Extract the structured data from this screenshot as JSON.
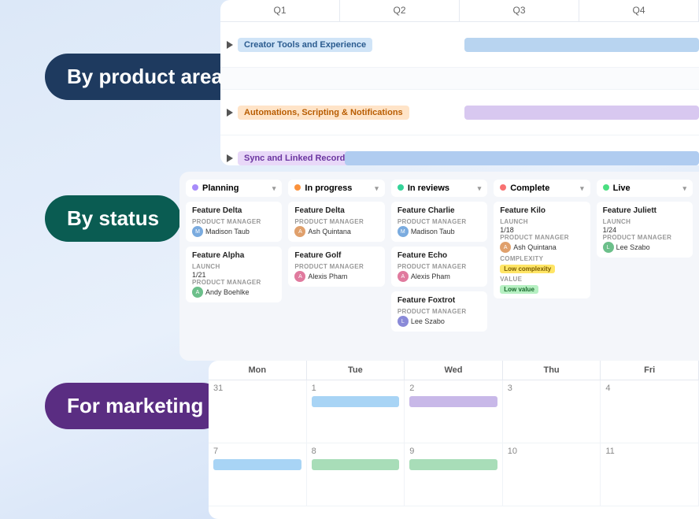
{
  "section1": {
    "label": "By product area",
    "quarters": [
      "Q1",
      "Q2",
      "Q3",
      "Q4"
    ],
    "rows": [
      {
        "name": "Creator Tools and Experience",
        "tag_class": "tag-blue"
      },
      {
        "name": "Automations, Scripting & Notifications",
        "tag_class": "tag-orange"
      },
      {
        "name": "Sync and Linked Records",
        "tag_class": "tag-purple-light"
      }
    ]
  },
  "section2": {
    "label": "By status",
    "columns": [
      {
        "status": "Planning",
        "color": "#a78bfa",
        "cards": [
          {
            "title": "Feature Delta",
            "pm_label": "PRODUCT MANAGER",
            "pm": "Madison Taub",
            "avatar_class": "blue"
          },
          {
            "title": "Feature Alpha",
            "launch_label": "LAUNCH",
            "launch": "1/21",
            "pm_label": "PRODUCT MANAGER",
            "pm": "Andy Boehlke",
            "avatar_class": "green"
          }
        ]
      },
      {
        "status": "In progress",
        "color": "#fb923c",
        "cards": [
          {
            "title": "Feature Delta",
            "pm_label": "PRODUCT MANAGER",
            "pm": "Ash Quintana",
            "avatar_class": "orange"
          },
          {
            "title": "Feature Golf",
            "pm_label": "PRODUCT MANAGER",
            "pm": "Alexis Pham",
            "avatar_class": "pink"
          }
        ]
      },
      {
        "status": "In reviews",
        "color": "#34d399",
        "cards": [
          {
            "title": "Feature Charlie",
            "pm_label": "PRODUCT MANAGER",
            "pm": "Madison Taub",
            "avatar_class": "blue"
          },
          {
            "title": "Feature Echo",
            "pm_label": "PRODUCT MANAGER",
            "pm": "Alexis Pham",
            "avatar_class": "pink"
          },
          {
            "title": "Feature Foxtrot",
            "pm_label": "PRODUCT MANAGER",
            "pm": "Lee Szabo",
            "avatar_class": "purple"
          }
        ]
      },
      {
        "status": "Complete",
        "color": "#f87171",
        "cards": [
          {
            "title": "Feature Kilo",
            "launch_label": "LAUNCH",
            "launch": "1/18",
            "pm_label": "PRODUCT MANAGER",
            "pm": "Ash Quintana",
            "avatar_class": "orange",
            "complexity_label": "COMPLEXITY",
            "complexity": "Low complexity",
            "value_label": "VALUE",
            "value": "Low value"
          }
        ]
      },
      {
        "status": "Live",
        "color": "#4ade80",
        "cards": [
          {
            "title": "Feature Juliett",
            "launch_label": "LAUNCH",
            "launch": "1/24",
            "pm_label": "PRODUCT MANAGER",
            "pm": "Lee Szabo",
            "avatar_class": "green"
          }
        ]
      }
    ]
  },
  "section3": {
    "label": "For marketing",
    "days": [
      "Mon",
      "Tue",
      "Wed",
      "Thu",
      "Fri"
    ],
    "week1": {
      "dates": [
        "31",
        "1",
        "2",
        "3",
        "4"
      ],
      "events": {
        "tue": [
          "ev-blue"
        ],
        "wed": [
          "ev-purple"
        ]
      }
    },
    "week2": {
      "dates": [
        "7",
        "8",
        "9",
        "10",
        "11"
      ],
      "events": {
        "mon": [
          "ev-blue"
        ],
        "tue": [
          "ev-green"
        ],
        "wed": [
          "ev-green"
        ]
      }
    }
  }
}
